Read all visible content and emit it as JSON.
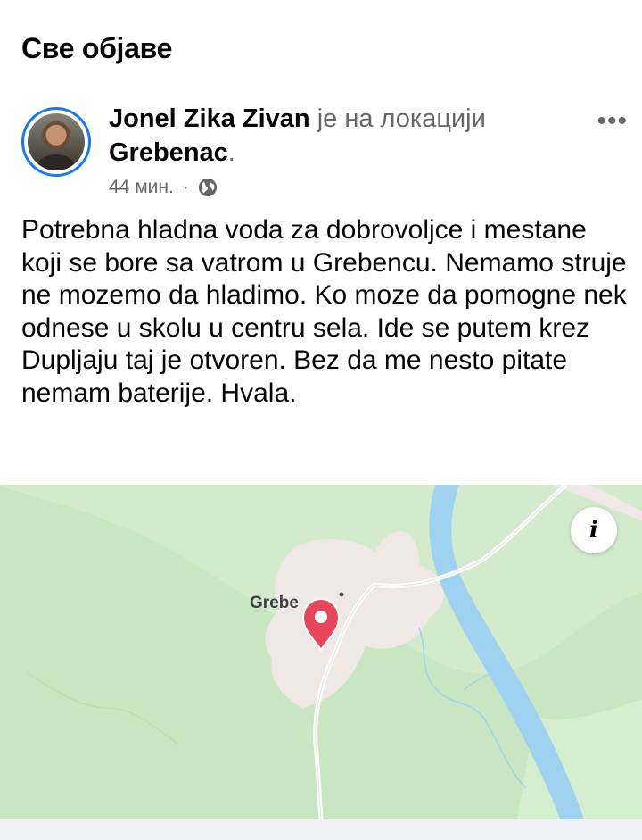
{
  "section": {
    "title": "Све објаве"
  },
  "post": {
    "author": "Jonel Zika Zivan",
    "action": " је на локацији",
    "location": "Grebenac",
    "location_suffix": ".",
    "time": "44 мин.",
    "separator": "·",
    "privacy_icon": "globe-icon",
    "more_icon": "•••",
    "text": "Potrebna hladna voda za dobrovoljce i mestane koji se bore sa vatrom u Grebencu. Nemamo struje ne mozemo da hladimo. Ko moze da pomogne nek odnese u skolu u centru sela. Ide se putem krez Dupljaju taj je otvoren. Bez da me nesto pitate nemam baterije. Hvala."
  },
  "map": {
    "label": "Grebe",
    "info_label": "i",
    "colors": {
      "land": "#c9e6c2",
      "water": "#9fd2f0",
      "town": "#efe8e5",
      "road": "#ffffff",
      "pin": "#e8465c"
    }
  }
}
